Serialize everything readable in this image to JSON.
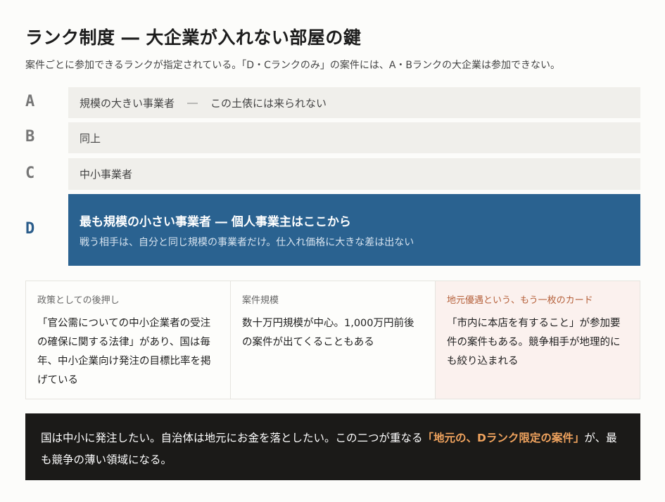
{
  "title": "ランク制度 ― 大企業が入れない部屋の鍵",
  "subtitle": "案件ごとに参加できるランクが指定されている。「D・Cランクのみ」の案件には、A・Bランクの大企業は参加できない。",
  "ranks": [
    {
      "letter": "A",
      "text": "規模の大きい事業者",
      "dash": "―",
      "note": "この土俵には来られない"
    },
    {
      "letter": "B",
      "text": "同上"
    },
    {
      "letter": "C",
      "text": "中小事業者"
    },
    {
      "letter": "D",
      "head": "最も規模の小さい事業者 ― 個人事業主はここから",
      "sub": "戦う相手は、自分と同じ規模の事業者だけ。仕入れ価格に大きな差は出ない"
    }
  ],
  "cards": [
    {
      "title": "政策としての後押し",
      "body": "「官公需についての中小企業者の受注の確保に関する法律」があり、国は毎年、中小企業向け発注の目標比率を掲げている"
    },
    {
      "title": "案件規模",
      "body": "数十万円規模が中心。1,000万円前後の案件が出てくることもある"
    },
    {
      "title": "地元優遇という、もう一枚のカード",
      "body": "「市内に本店を有すること」が参加要件の案件もある。競争相手が地理的にも絞り込まれる"
    }
  ],
  "banner": {
    "text_before": "国は中小に発注したい。自治体は地元にお金を落としたい。この二つが重なる",
    "highlight": "「地元の、Dランク限定の案件」",
    "text_after": "が、最も競争の薄い領域になる。"
  }
}
